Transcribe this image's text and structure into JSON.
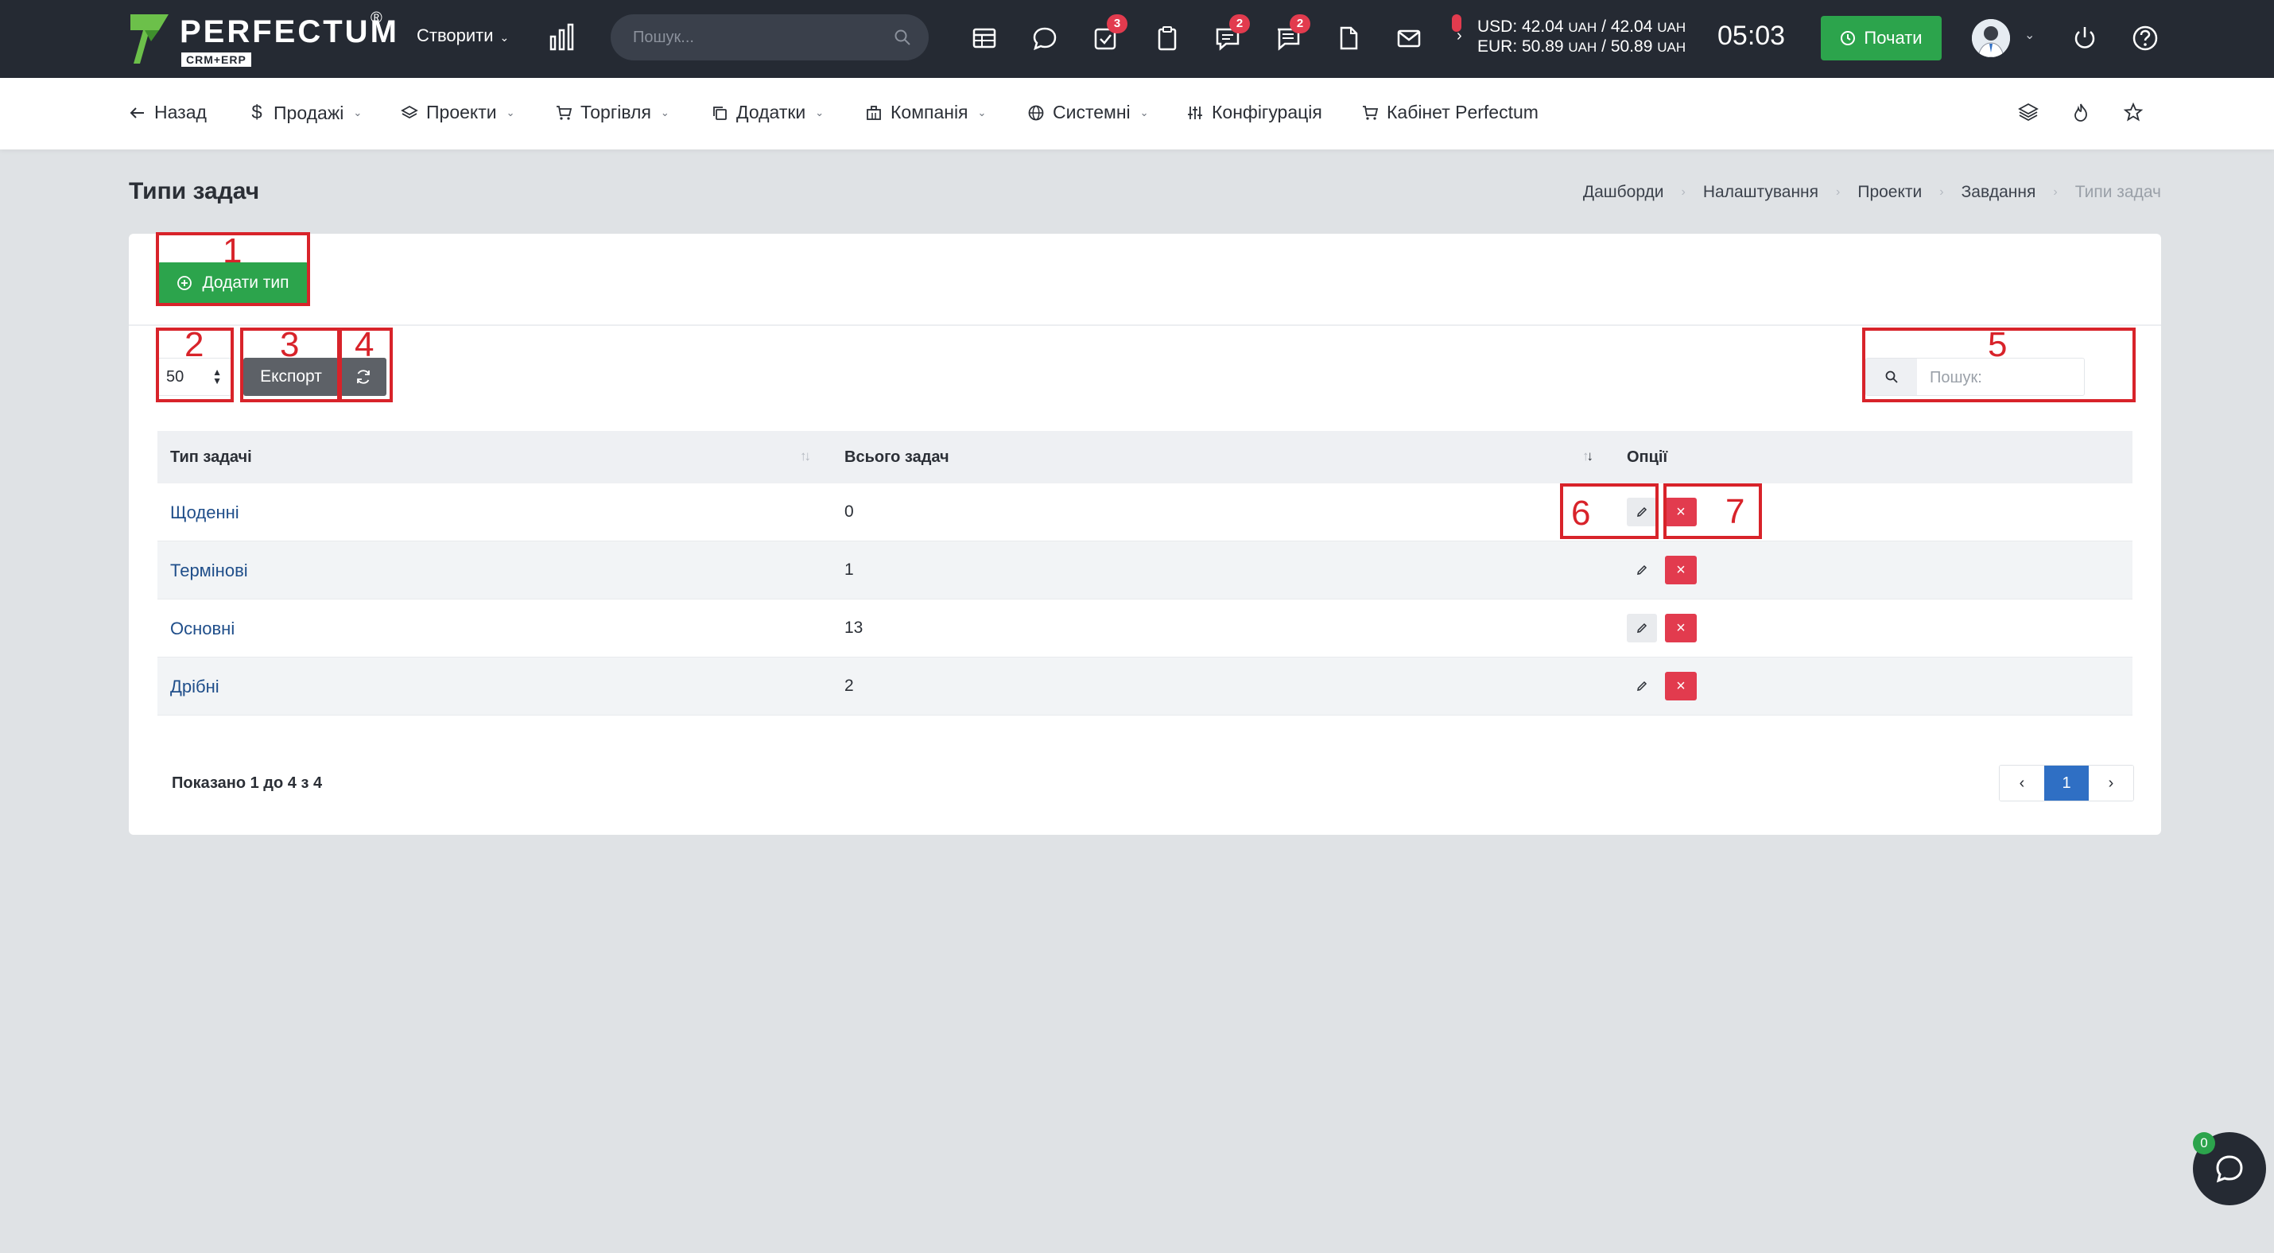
{
  "app": {
    "logo_text": "PERFECTUM",
    "logo_reg": "®",
    "logo_sub": "CRM+ERP"
  },
  "topbar": {
    "create_label": "Створити",
    "search_placeholder": "Пошук...",
    "badges": {
      "tasks": "3",
      "chat": "2",
      "messages": "2"
    },
    "rates": {
      "usd_label": "USD: 42.04",
      "usd_unit_1": "UAH",
      "usd_sep": " / 42.04",
      "usd_unit_2": "UAH",
      "eur_label": "EUR: 50.89",
      "eur_unit_1": "UAH",
      "eur_sep": " / 50.89",
      "eur_unit_2": "UAH"
    },
    "clock": "05:03",
    "start_label": "Почати"
  },
  "nav": {
    "back": "Назад",
    "sales": "Продажі",
    "projects": "Проекти",
    "trade": "Торгівля",
    "addons": "Додатки",
    "company": "Компанія",
    "system": "Системні",
    "config": "Конфігурація",
    "cabinet": "Кабінет Perfectum"
  },
  "page": {
    "title": "Типи задач",
    "breadcrumb": [
      "Дашборди",
      "Налаштування",
      "Проекти",
      "Завдання",
      "Типи задач"
    ]
  },
  "toolbar": {
    "add_label": "Додати тип",
    "page_length": "50",
    "export_label": "Експорт",
    "search_placeholder": "Пошук:"
  },
  "table": {
    "columns": [
      "Тип задачі",
      "Всього задач",
      "Опції"
    ],
    "rows": [
      {
        "type": "Щоденні",
        "total": "0"
      },
      {
        "type": "Термінові",
        "total": "1"
      },
      {
        "type": "Основні",
        "total": "13"
      },
      {
        "type": "Дрібні",
        "total": "2"
      }
    ],
    "summary": "Показано 1 до 4 з 4",
    "current_page": "1"
  },
  "annotations": [
    "1",
    "2",
    "3",
    "4",
    "5",
    "6",
    "7"
  ],
  "chat": {
    "badge": "0"
  },
  "colors": {
    "topbar": "#252a33",
    "accent_green": "#2ca44c",
    "danger": "#e23b4e",
    "link": "#1f4e8a",
    "pager_active": "#2f6fc4",
    "annotation": "#d8232a"
  }
}
